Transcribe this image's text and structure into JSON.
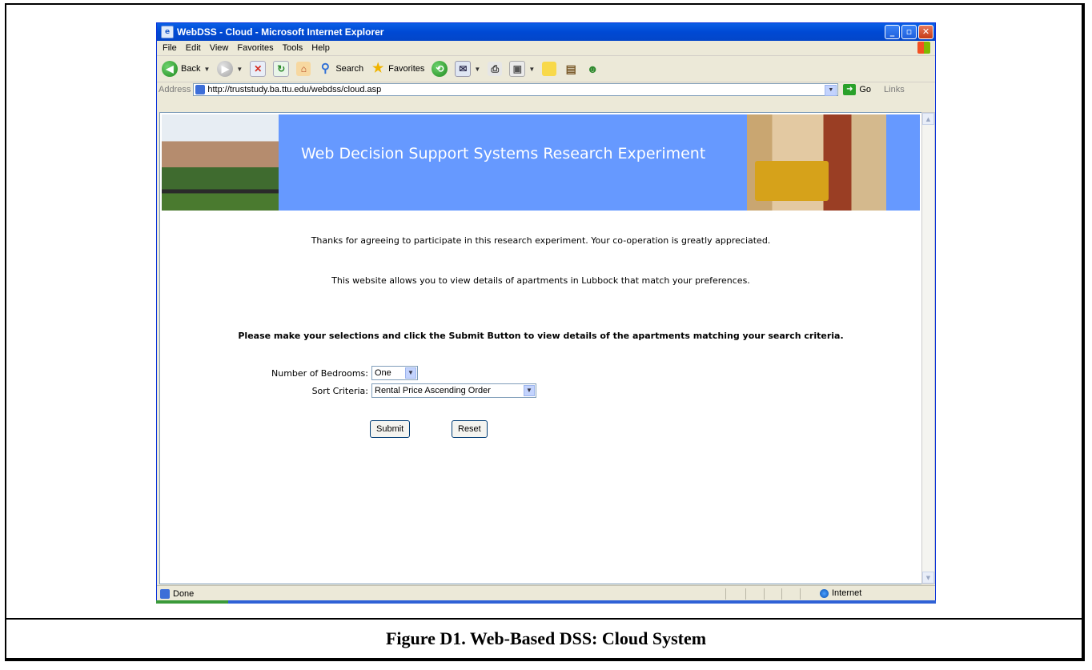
{
  "window": {
    "title": "WebDSS - Cloud - Microsoft Internet Explorer"
  },
  "menu": [
    "File",
    "Edit",
    "View",
    "Favorites",
    "Tools",
    "Help"
  ],
  "toolbar": {
    "back": "Back",
    "search": "Search",
    "favorites": "Favorites"
  },
  "address": {
    "label": "Address",
    "url": "http://truststudy.ba.ttu.edu/webdss/cloud.asp",
    "go": "Go",
    "links": "Links"
  },
  "page": {
    "banner_title": "Web Decision Support Systems Research Experiment",
    "thanks": "Thanks for agreeing to participate in this research experiment. Your co-operation is greatly appreciated.",
    "intro": "This website allows you to view details of  apartments in Lubbock that match your preferences.",
    "instructions": "Please make your selections and click the Submit Button to view details of the apartments matching your search criteria.",
    "bedrooms_label": "Number of Bedrooms:",
    "bedrooms_value": "One",
    "sort_label": "Sort Criteria:",
    "sort_value": "Rental Price Ascending Order",
    "submit": "Submit",
    "reset": "Reset"
  },
  "status": {
    "text": "Done",
    "zone": "Internet"
  },
  "caption": "Figure D1.  Web-Based DSS:  Cloud System"
}
